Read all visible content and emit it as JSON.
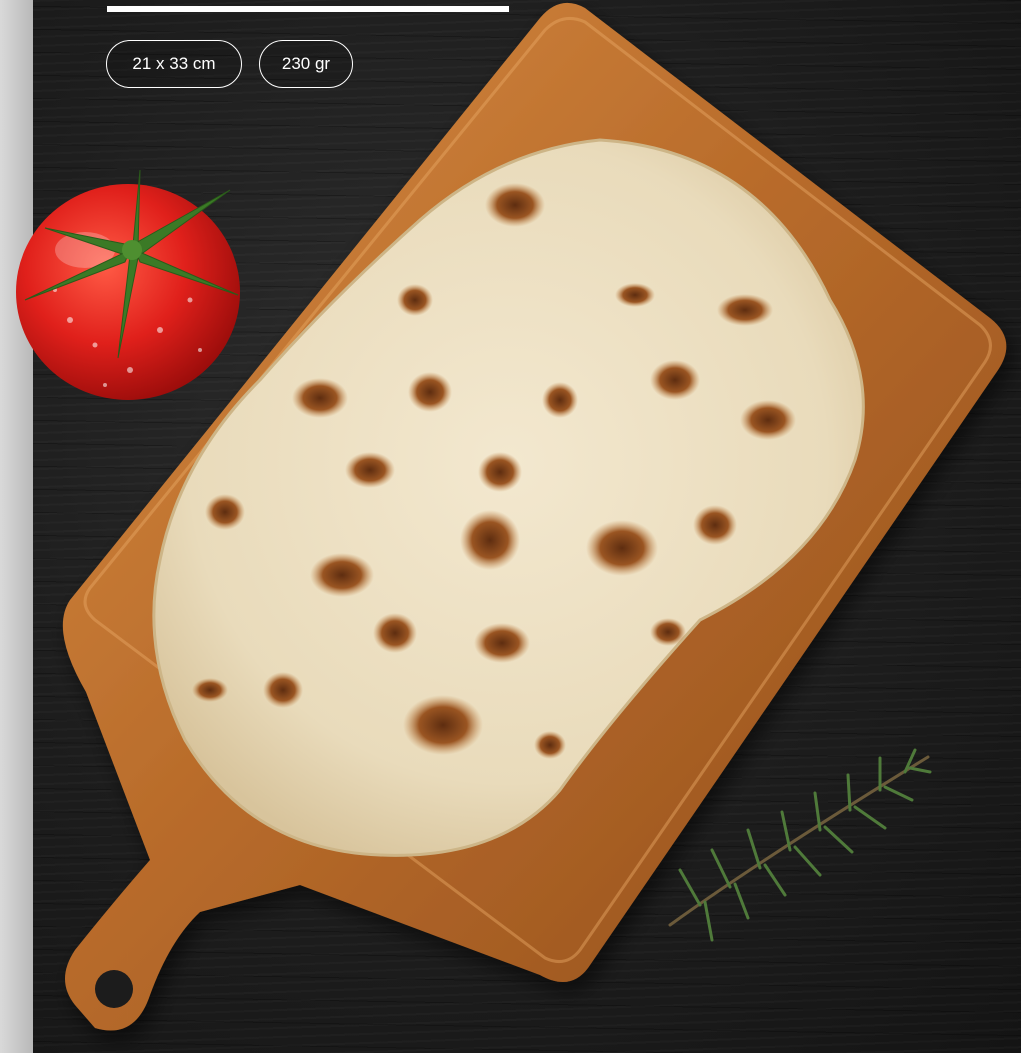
{
  "badges": {
    "size": "21 x 33 cm",
    "weight": "230 gr"
  },
  "icons": [
    "tomato-icon",
    "rosemary-icon"
  ],
  "colors": {
    "background": "#1b1b1b",
    "board": "#c2782f",
    "flatbread": "#efe2c6",
    "tomato": "#e0201b",
    "rosemary": "#4f7a3a",
    "badge_border": "#ffffff"
  }
}
